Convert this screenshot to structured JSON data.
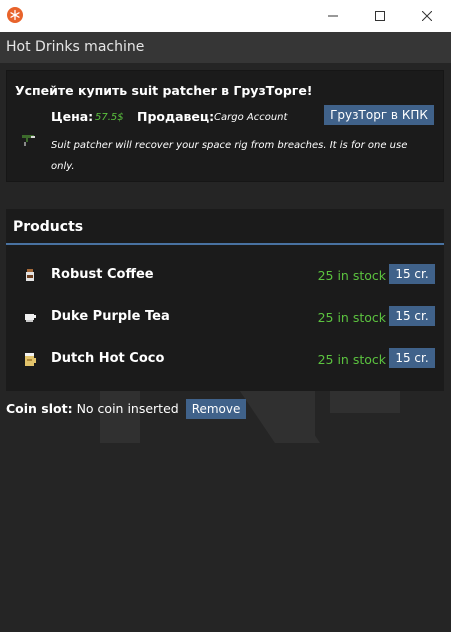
{
  "window": {
    "minimize_icon": "minimize-icon",
    "maximize_icon": "maximize-icon",
    "close_icon": "close-icon"
  },
  "header": {
    "title": "Hot Drinks machine"
  },
  "promo": {
    "title": "Успейте купить suit patcher в ГрузТорге!",
    "price_label": "Цена:",
    "price": "57.5$",
    "seller_label": "Продавец:",
    "seller": "Cargo Account",
    "description": "Suit patcher will recover your space rig from breaches. It is for one use only.",
    "button_label": "ГрузТорг в КПК"
  },
  "products": {
    "title": "Products",
    "items": [
      {
        "name": "Robust Coffee",
        "stock": "25 in stock",
        "price": "15 cr.",
        "icon": "coffee-icon"
      },
      {
        "name": "Duke Purple Tea",
        "stock": "25 in stock",
        "price": "15 cr.",
        "icon": "tea-icon"
      },
      {
        "name": "Dutch Hot Coco",
        "stock": "25 in stock",
        "price": "15 cr.",
        "icon": "cocoa-icon"
      }
    ]
  },
  "coin_slot": {
    "label": "Coin slot:",
    "value": "No coin inserted",
    "remove_label": "Remove"
  },
  "colors": {
    "accent": "#40628a",
    "stock_green": "#5bc23f",
    "panel": "#1b1b1b",
    "background": "#252525"
  }
}
